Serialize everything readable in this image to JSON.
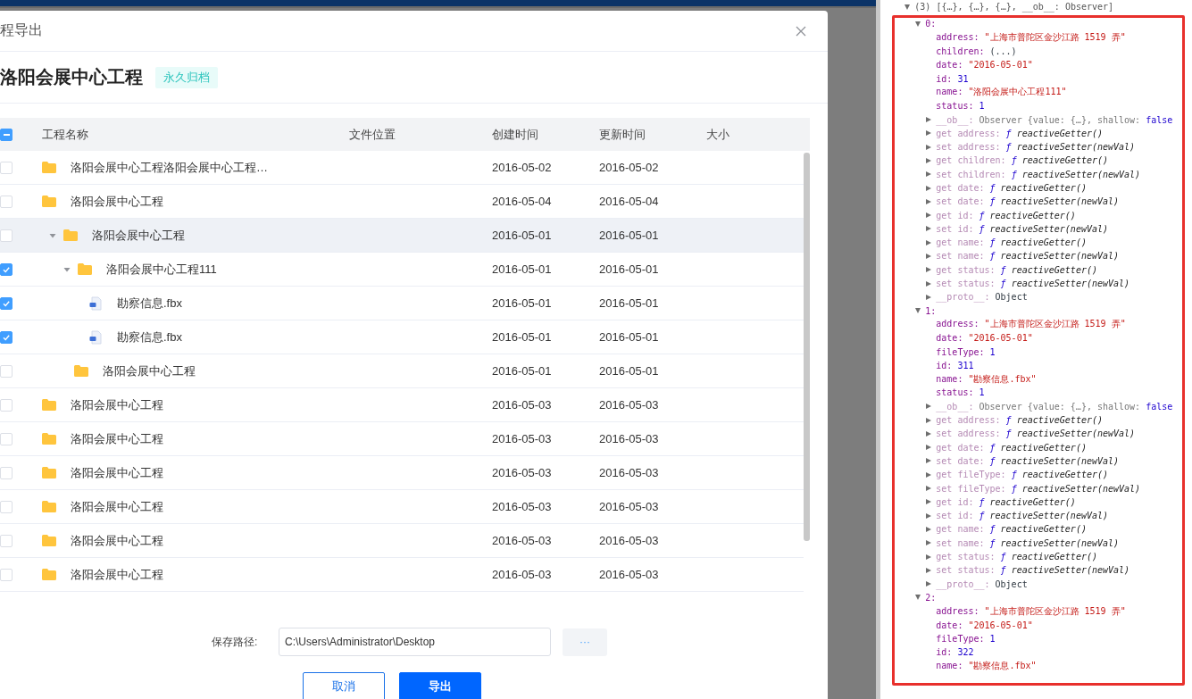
{
  "dialog": {
    "title": "程导出",
    "project": {
      "name": "洛阳会展中心工程",
      "tag": "永久归档"
    },
    "table": {
      "indeterminate": true,
      "columns": [
        "工程名称",
        "文件位置",
        "创建时间",
        "更新时间",
        "大小"
      ],
      "rows": [
        {
          "kind": "folder",
          "name": "洛阳会展中心工程洛阳会展中心工程…",
          "created": "2016-05-02",
          "updated": "2016-05-02",
          "checked": false,
          "highlighted": false
        },
        {
          "kind": "folder",
          "name": "洛阳会展中心工程",
          "created": "2016-05-04",
          "updated": "2016-05-04",
          "checked": false,
          "highlighted": false
        },
        {
          "kind": "folder",
          "name": "洛阳会展中心工程",
          "created": "2016-05-01",
          "updated": "2016-05-01",
          "checked": false,
          "highlighted": true,
          "expanded": true,
          "children": [
            {
              "kind": "folder",
              "name": "洛阳会展中心工程111",
              "created": "2016-05-01",
              "updated": "2016-05-01",
              "checked": true,
              "highlighted": false,
              "expanded": true,
              "children": [
                {
                  "kind": "file",
                  "name": "勘察信息.fbx",
                  "created": "2016-05-01",
                  "updated": "2016-05-01",
                  "checked": true,
                  "highlighted": false
                },
                {
                  "kind": "file",
                  "name": "勘察信息.fbx",
                  "created": "2016-05-01",
                  "updated": "2016-05-01",
                  "checked": true,
                  "highlighted": false
                }
              ]
            },
            {
              "kind": "folder",
              "name": "洛阳会展中心工程",
              "created": "2016-05-01",
              "updated": "2016-05-01",
              "checked": false,
              "highlighted": false
            }
          ]
        },
        {
          "kind": "folder",
          "name": "洛阳会展中心工程",
          "created": "2016-05-03",
          "updated": "2016-05-03",
          "checked": false,
          "highlighted": false
        },
        {
          "kind": "folder",
          "name": "洛阳会展中心工程",
          "created": "2016-05-03",
          "updated": "2016-05-03",
          "checked": false,
          "highlighted": false
        },
        {
          "kind": "folder",
          "name": "洛阳会展中心工程",
          "created": "2016-05-03",
          "updated": "2016-05-03",
          "checked": false,
          "highlighted": false
        },
        {
          "kind": "folder",
          "name": "洛阳会展中心工程",
          "created": "2016-05-03",
          "updated": "2016-05-03",
          "checked": false,
          "highlighted": false
        },
        {
          "kind": "folder",
          "name": "洛阳会展中心工程",
          "created": "2016-05-03",
          "updated": "2016-05-03",
          "checked": false,
          "highlighted": false
        },
        {
          "kind": "folder",
          "name": "洛阳会展中心工程",
          "created": "2016-05-03",
          "updated": "2016-05-03",
          "checked": false,
          "highlighted": false
        }
      ]
    },
    "save_path": {
      "label": "保存路径:",
      "value": "C:\\Users\\Administrator\\Desktop",
      "browse": "···"
    },
    "buttons": [
      {
        "label": "取消",
        "kind": "secondary"
      },
      {
        "label": "导出",
        "kind": "primary"
      }
    ]
  },
  "console": {
    "header": "(3) [{…}, {…}, {…}, __ob__: Observer]",
    "expanded": true,
    "items": [
      {
        "index": "0:",
        "expanded": true,
        "lines": [
          {
            "kind": "string",
            "key": "address:",
            "value": "\"上海市普陀区金沙江路 1519 弄\""
          },
          {
            "kind": "lazy",
            "key": "children:",
            "value": "(...)"
          },
          {
            "kind": "string",
            "key": "date:",
            "value": "\"2016-05-01\""
          },
          {
            "kind": "number",
            "key": "id:",
            "value": "31"
          },
          {
            "kind": "string",
            "key": "name:",
            "value": "\"洛阳会展中心工程111\""
          },
          {
            "kind": "number",
            "key": "status:",
            "value": "1"
          },
          {
            "kind": "observer",
            "key": "__ob__:",
            "value": "Observer {value: {…}, shallow:",
            "flag": "false",
            "expanded": false
          },
          {
            "kind": "accessor",
            "key": "get address:",
            "marker": "ƒ",
            "fn": "reactiveGetter()",
            "expanded": false
          },
          {
            "kind": "accessor",
            "key": "set address:",
            "marker": "ƒ",
            "fn": "reactiveSetter(newVal)",
            "expanded": false
          },
          {
            "kind": "accessor",
            "key": "get children:",
            "marker": "ƒ",
            "fn": "reactiveGetter()",
            "expanded": false
          },
          {
            "kind": "accessor",
            "key": "set children:",
            "marker": "ƒ",
            "fn": "reactiveSetter(newVal)",
            "expanded": false
          },
          {
            "kind": "accessor",
            "key": "get date:",
            "marker": "ƒ",
            "fn": "reactiveGetter()",
            "expanded": false
          },
          {
            "kind": "accessor",
            "key": "set date:",
            "marker": "ƒ",
            "fn": "reactiveSetter(newVal)",
            "expanded": false
          },
          {
            "kind": "accessor",
            "key": "get id:",
            "marker": "ƒ",
            "fn": "reactiveGetter()",
            "expanded": false
          },
          {
            "kind": "accessor",
            "key": "set id:",
            "marker": "ƒ",
            "fn": "reactiveSetter(newVal)",
            "expanded": false
          },
          {
            "kind": "accessor",
            "key": "get name:",
            "marker": "ƒ",
            "fn": "reactiveGetter()",
            "expanded": false
          },
          {
            "kind": "accessor",
            "key": "set name:",
            "marker": "ƒ",
            "fn": "reactiveSetter(newVal)",
            "expanded": false
          },
          {
            "kind": "accessor",
            "key": "get status:",
            "marker": "ƒ",
            "fn": "reactiveGetter()",
            "expanded": false
          },
          {
            "kind": "accessor",
            "key": "set status:",
            "marker": "ƒ",
            "fn": "reactiveSetter(newVal)",
            "expanded": false
          },
          {
            "kind": "proto",
            "key": "__proto__:",
            "value": "Object",
            "expanded": false
          }
        ]
      },
      {
        "index": "1:",
        "expanded": true,
        "lines": [
          {
            "kind": "string",
            "key": "address:",
            "value": "\"上海市普陀区金沙江路 1519 弄\""
          },
          {
            "kind": "string",
            "key": "date:",
            "value": "\"2016-05-01\""
          },
          {
            "kind": "number",
            "key": "fileType:",
            "value": "1"
          },
          {
            "kind": "number",
            "key": "id:",
            "value": "311"
          },
          {
            "kind": "string",
            "key": "name:",
            "value": "\"勘察信息.fbx\""
          },
          {
            "kind": "number",
            "key": "status:",
            "value": "1"
          },
          {
            "kind": "observer",
            "key": "__ob__:",
            "value": "Observer {value: {…}, shallow:",
            "flag": "false",
            "expanded": false
          },
          {
            "kind": "accessor",
            "key": "get address:",
            "marker": "ƒ",
            "fn": "reactiveGetter()",
            "expanded": false
          },
          {
            "kind": "accessor",
            "key": "set address:",
            "marker": "ƒ",
            "fn": "reactiveSetter(newVal)",
            "expanded": false
          },
          {
            "kind": "accessor",
            "key": "get date:",
            "marker": "ƒ",
            "fn": "reactiveGetter()",
            "expanded": false
          },
          {
            "kind": "accessor",
            "key": "set date:",
            "marker": "ƒ",
            "fn": "reactiveSetter(newVal)",
            "expanded": false
          },
          {
            "kind": "accessor",
            "key": "get fileType:",
            "marker": "ƒ",
            "fn": "reactiveGetter()",
            "expanded": false
          },
          {
            "kind": "accessor",
            "key": "set fileType:",
            "marker": "ƒ",
            "fn": "reactiveSetter(newVal)",
            "expanded": false
          },
          {
            "kind": "accessor",
            "key": "get id:",
            "marker": "ƒ",
            "fn": "reactiveGetter()",
            "expanded": false
          },
          {
            "kind": "accessor",
            "key": "set id:",
            "marker": "ƒ",
            "fn": "reactiveSetter(newVal)",
            "expanded": false
          },
          {
            "kind": "accessor",
            "key": "get name:",
            "marker": "ƒ",
            "fn": "reactiveGetter()",
            "expanded": false
          },
          {
            "kind": "accessor",
            "key": "set name:",
            "marker": "ƒ",
            "fn": "reactiveSetter(newVal)",
            "expanded": false
          },
          {
            "kind": "accessor",
            "key": "get status:",
            "marker": "ƒ",
            "fn": "reactiveGetter()",
            "expanded": false
          },
          {
            "kind": "accessor",
            "key": "set status:",
            "marker": "ƒ",
            "fn": "reactiveSetter(newVal)",
            "expanded": false
          },
          {
            "kind": "proto",
            "key": "__proto__:",
            "value": "Object",
            "expanded": false
          }
        ]
      },
      {
        "index": "2:",
        "expanded": true,
        "lines": [
          {
            "kind": "string",
            "key": "address:",
            "value": "\"上海市普陀区金沙江路 1519 弄\""
          },
          {
            "kind": "string",
            "key": "date:",
            "value": "\"2016-05-01\""
          },
          {
            "kind": "number",
            "key": "fileType:",
            "value": "1"
          },
          {
            "kind": "number",
            "key": "id:",
            "value": "322"
          },
          {
            "kind": "string",
            "key": "name:",
            "value": "\"勘察信息.fbx\""
          }
        ]
      }
    ]
  }
}
